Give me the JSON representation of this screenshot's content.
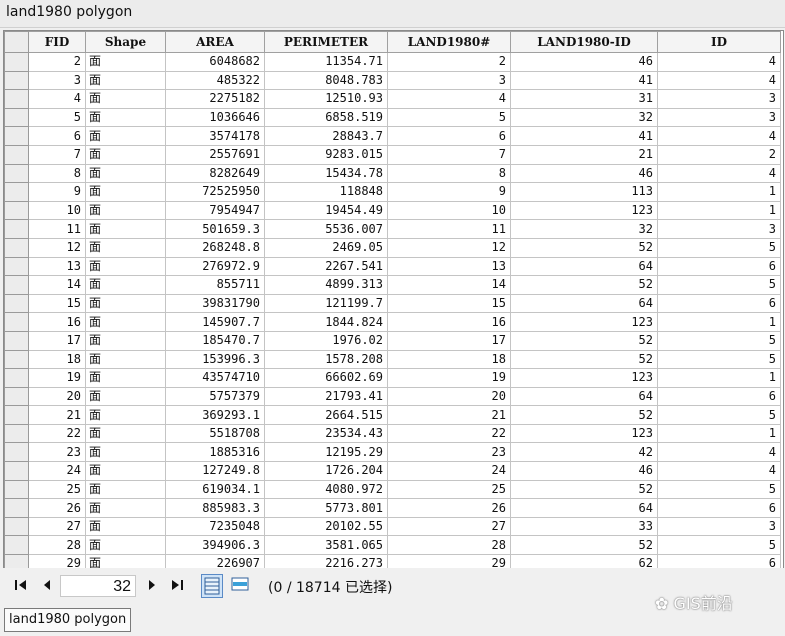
{
  "window": {
    "title": "land1980 polygon"
  },
  "table": {
    "columns": [
      "FID",
      "Shape",
      "AREA",
      "PERIMETER",
      "LAND1980#",
      "LAND1980-ID",
      "ID"
    ],
    "rows": [
      [
        "2",
        "面",
        "6048682",
        "11354.71",
        "2",
        "46",
        "4"
      ],
      [
        "3",
        "面",
        "485322",
        "8048.783",
        "3",
        "41",
        "4"
      ],
      [
        "4",
        "面",
        "2275182",
        "12510.93",
        "4",
        "31",
        "3"
      ],
      [
        "5",
        "面",
        "1036646",
        "6858.519",
        "5",
        "32",
        "3"
      ],
      [
        "6",
        "面",
        "3574178",
        "28843.7",
        "6",
        "41",
        "4"
      ],
      [
        "7",
        "面",
        "2557691",
        "9283.015",
        "7",
        "21",
        "2"
      ],
      [
        "8",
        "面",
        "8282649",
        "15434.78",
        "8",
        "46",
        "4"
      ],
      [
        "9",
        "面",
        "72525950",
        "118848",
        "9",
        "113",
        "1"
      ],
      [
        "10",
        "面",
        "7954947",
        "19454.49",
        "10",
        "123",
        "1"
      ],
      [
        "11",
        "面",
        "501659.3",
        "5536.007",
        "11",
        "32",
        "3"
      ],
      [
        "12",
        "面",
        "268248.8",
        "2469.05",
        "12",
        "52",
        "5"
      ],
      [
        "13",
        "面",
        "276972.9",
        "2267.541",
        "13",
        "64",
        "6"
      ],
      [
        "14",
        "面",
        "855711",
        "4899.313",
        "14",
        "52",
        "5"
      ],
      [
        "15",
        "面",
        "39831790",
        "121199.7",
        "15",
        "64",
        "6"
      ],
      [
        "16",
        "面",
        "145907.7",
        "1844.824",
        "16",
        "123",
        "1"
      ],
      [
        "17",
        "面",
        "185470.7",
        "1976.02",
        "17",
        "52",
        "5"
      ],
      [
        "18",
        "面",
        "153996.3",
        "1578.208",
        "18",
        "52",
        "5"
      ],
      [
        "19",
        "面",
        "43574710",
        "66602.69",
        "19",
        "123",
        "1"
      ],
      [
        "20",
        "面",
        "5757379",
        "21793.41",
        "20",
        "64",
        "6"
      ],
      [
        "21",
        "面",
        "369293.1",
        "2664.515",
        "21",
        "52",
        "5"
      ],
      [
        "22",
        "面",
        "5518708",
        "23534.43",
        "22",
        "123",
        "1"
      ],
      [
        "23",
        "面",
        "1885316",
        "12195.29",
        "23",
        "42",
        "4"
      ],
      [
        "24",
        "面",
        "127249.8",
        "1726.204",
        "24",
        "46",
        "4"
      ],
      [
        "25",
        "面",
        "619034.1",
        "4080.972",
        "25",
        "52",
        "5"
      ],
      [
        "26",
        "面",
        "885983.3",
        "5773.801",
        "26",
        "64",
        "6"
      ],
      [
        "27",
        "面",
        "7235048",
        "20102.55",
        "27",
        "33",
        "3"
      ],
      [
        "28",
        "面",
        "394906.3",
        "3581.065",
        "28",
        "52",
        "5"
      ],
      [
        "29",
        "面",
        "226907",
        "2216.273",
        "29",
        "62",
        "6"
      ]
    ]
  },
  "navigation": {
    "current_record": "32",
    "selection_status": "(0 / 18714 已选择)"
  },
  "icons": {
    "first": "first-record-icon",
    "prev": "previous-record-icon",
    "next": "next-record-icon",
    "last": "last-record-icon",
    "show_all": "show-all-records-icon",
    "show_selected": "show-selected-records-icon"
  },
  "watermark": {
    "text": "GIS前沿"
  },
  "tab": {
    "label": "land1980 polygon"
  }
}
